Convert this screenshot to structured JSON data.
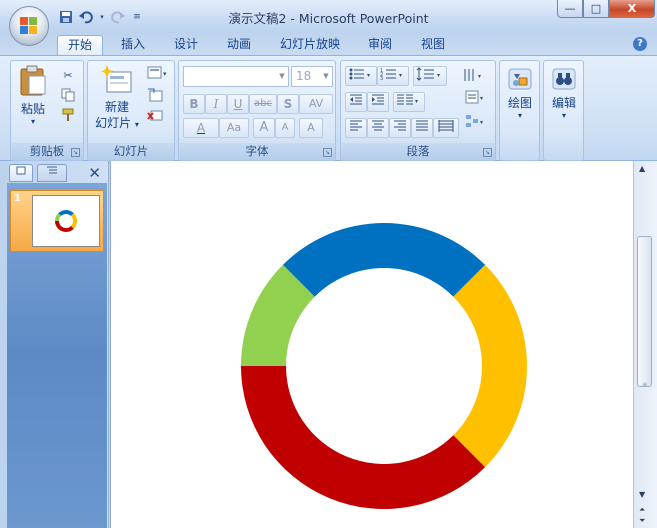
{
  "window": {
    "title": "演示文稿2 - Microsoft PowerPoint",
    "buttons": {
      "minimize": "—",
      "maximize": "□",
      "close": "X"
    }
  },
  "quick_access": [
    "save-icon",
    "undo-icon",
    "redo-icon",
    "customize-icon"
  ],
  "tabs": [
    {
      "label": "开始",
      "active": true
    },
    {
      "label": "插入"
    },
    {
      "label": "设计"
    },
    {
      "label": "动画"
    },
    {
      "label": "幻灯片放映"
    },
    {
      "label": "审阅"
    },
    {
      "label": "视图"
    }
  ],
  "help": "?",
  "ribbon": {
    "clipboard": {
      "label": "剪贴板",
      "paste": "粘贴",
      "paste_arrow": "▾"
    },
    "slides": {
      "label": "幻灯片",
      "new_slide_line1": "新建",
      "new_slide_line2": "幻灯片",
      "arrow": "▾"
    },
    "font": {
      "label": "字体",
      "font_name": "",
      "font_size": "18",
      "bold": "B",
      "italic": "I",
      "underline": "U",
      "strike": "abc",
      "shadow": "S",
      "spacing": "AV",
      "font_color": "A",
      "change_case": "Aa",
      "grow": "A",
      "shrink": "A",
      "clear": "A"
    },
    "paragraph": {
      "label": "段落"
    },
    "drawing": {
      "label": "绘图",
      "arrow": "▾"
    },
    "editing": {
      "label": "编辑",
      "arrow": "▾"
    }
  },
  "slide_pane": {
    "close": "✕",
    "slide_number": "1"
  },
  "chart_data": {
    "type": "pie",
    "donut": true,
    "title": "",
    "slices": [
      {
        "color": "#0070c0",
        "value": 25
      },
      {
        "color": "#ffc000",
        "value": 25
      },
      {
        "color": "#c00000",
        "value": 37.5
      },
      {
        "color": "#92d050",
        "value": 12.5
      }
    ],
    "start_angle_deg": -45
  }
}
